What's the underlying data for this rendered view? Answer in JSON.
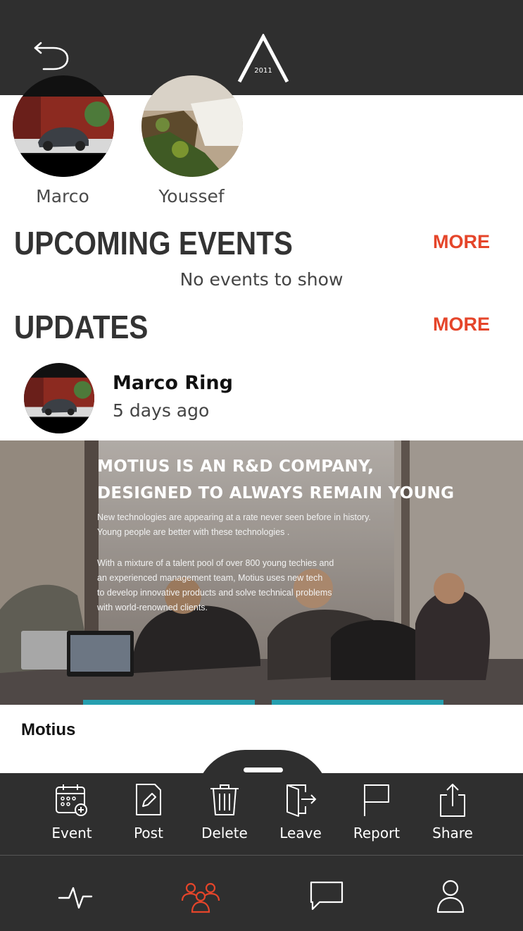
{
  "header": {
    "logo_year": "2011",
    "back_icon": "back-arrow-icon",
    "bg_color": "#2f2f2f"
  },
  "members": [
    {
      "name": "Marco"
    },
    {
      "name": "Youssef"
    }
  ],
  "upcoming_events": {
    "title": "UPCOMING EVENTS",
    "more_label": "MORE",
    "empty_message": "No events to show"
  },
  "updates": {
    "title": "UPDATES",
    "more_label": "MORE",
    "post": {
      "author": "Marco Ring",
      "time": "5 days ago",
      "image": {
        "headline_line1": "MOTIUS IS AN R&D COMPANY,",
        "headline_line2": "DESIGNED TO ALWAYS REMAIN YOUNG",
        "para1_line1": "New technologies are appearing at a rate never seen before in history.",
        "para1_line2": "Young people are better with these technologies .",
        "para2_line1": "With a mixture of a talent pool of over 800 young techies and",
        "para2_line2": "an experienced management team, Motius uses new tech",
        "para2_line3": "to develop innovative products and solve technical problems",
        "para2_line4": "with world-renowned clients."
      },
      "caption": "Motius"
    }
  },
  "actions": [
    {
      "label": "Event",
      "icon": "calendar-add-icon"
    },
    {
      "label": "Post",
      "icon": "edit-post-icon"
    },
    {
      "label": "Delete",
      "icon": "trash-icon"
    },
    {
      "label": "Leave",
      "icon": "exit-door-icon"
    },
    {
      "label": "Report",
      "icon": "flag-icon"
    },
    {
      "label": "Share",
      "icon": "share-icon"
    }
  ],
  "tabbar": {
    "active_color": "#e5452a",
    "tabs": [
      {
        "name": "activity",
        "icon": "pulse-icon",
        "active": false
      },
      {
        "name": "groups",
        "icon": "group-icon",
        "active": true
      },
      {
        "name": "messages",
        "icon": "chat-icon",
        "active": false
      },
      {
        "name": "profile",
        "icon": "user-icon",
        "active": false
      }
    ]
  },
  "colors": {
    "accent": "#e5452a",
    "dark": "#2f2f2f"
  }
}
